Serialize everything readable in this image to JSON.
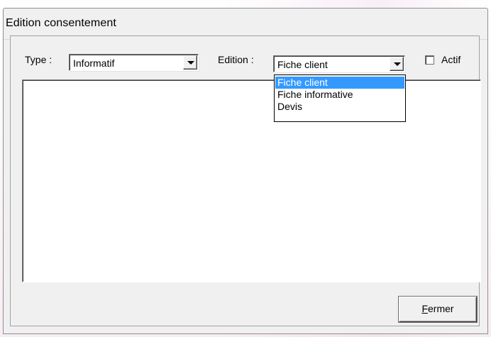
{
  "window": {
    "title": "Edition consentement"
  },
  "form": {
    "type_label": "Type :",
    "type_value": "Informatif",
    "edition_label": "Edition :",
    "edition_value": "Fiche client",
    "actif_label": "Actif",
    "actif_checked": false,
    "content_text": ""
  },
  "dropdown": {
    "options": [
      {
        "label": "Fiche client",
        "selected": true
      },
      {
        "label": "Fiche informative",
        "selected": false
      },
      {
        "label": "Devis",
        "selected": false
      }
    ],
    "highlight_color": "#3399ff"
  },
  "buttons": {
    "close_label": "ermer",
    "close_mnemonic": "F"
  },
  "icons": {
    "combo_arrow": "chevron-down-icon"
  }
}
